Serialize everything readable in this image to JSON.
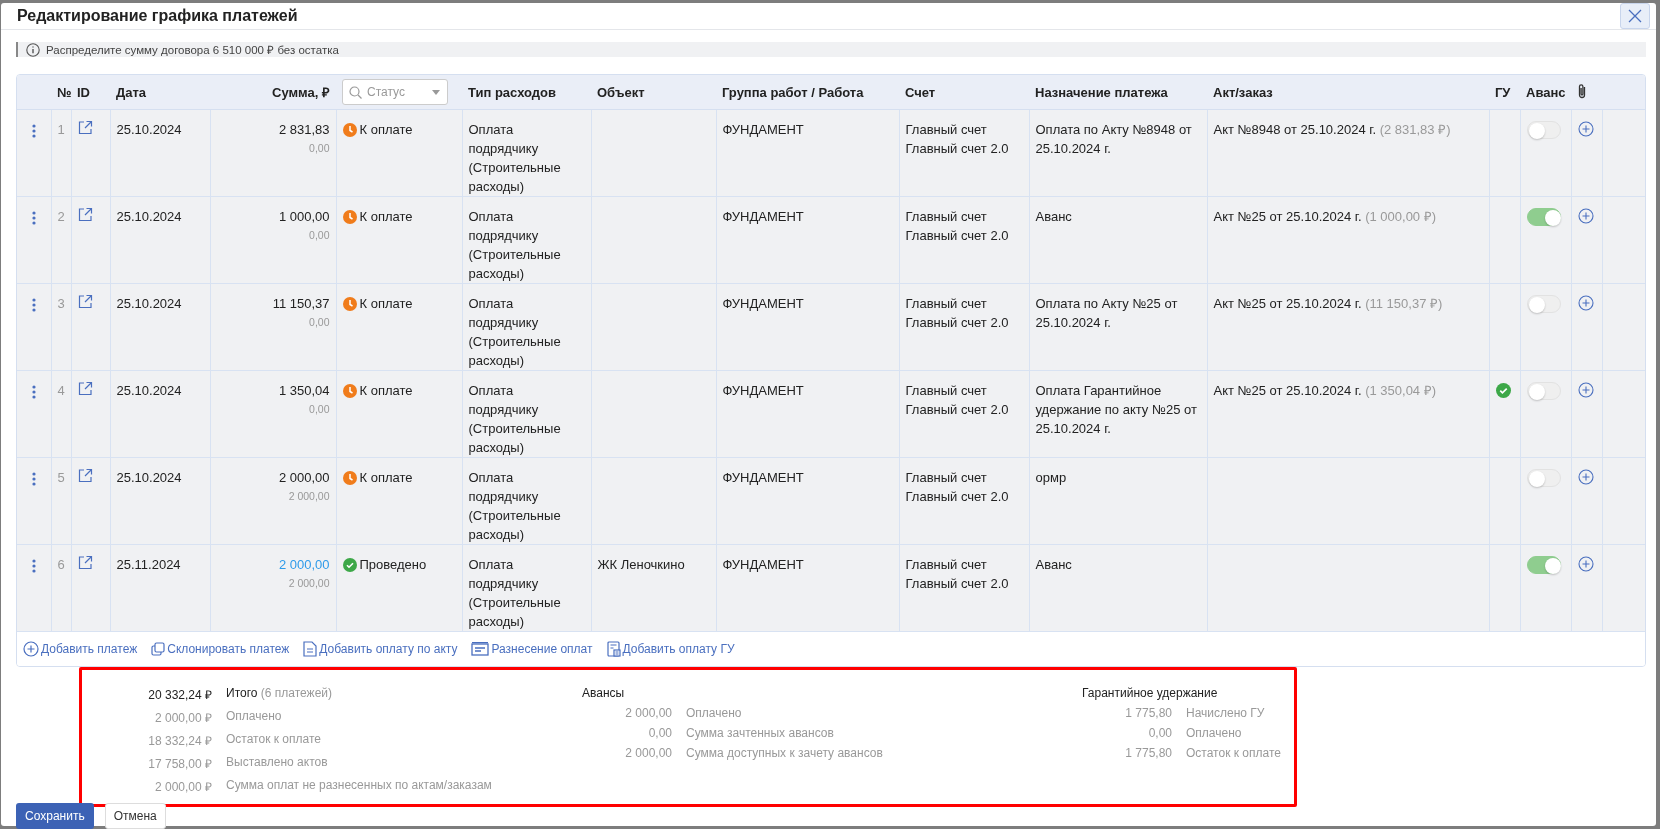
{
  "dialog": {
    "title": "Редактирование графика платежей"
  },
  "info": "Распределите сумму договора 6 510 000 ₽ без остатка",
  "table": {
    "columns": {
      "num": "№",
      "id": "ID",
      "date": "Дата",
      "amount": "Сумма, ₽",
      "status_filter": {
        "placeholder": "Статус"
      },
      "expense_type": "Тип расходов",
      "object": "Объект",
      "work_group": "Группа работ / Работа",
      "account": "Счет",
      "purpose": "Назначение платежа",
      "act": "Акт/заказ",
      "gu": "ГУ",
      "advance": "Аванс"
    },
    "rows": [
      {
        "num": "1",
        "date": "25.10.2024",
        "amount": "2 831,83",
        "amount_link": false,
        "amount_sub": "0,00",
        "status": {
          "kind": "pending",
          "label": "К оплате"
        },
        "expense_type": "Оплата подрядчику (Строительные расходы)",
        "object": "",
        "work_group": "ФУНДАМЕНТ",
        "account": [
          "Главный счет",
          "Главный счет 2.0"
        ],
        "purpose": "Оплата по Акту №8948 от 25.10.2024 г.",
        "act": "Акт №8948 от 25.10.2024 г.",
        "act_amount": "(2 831,83 ₽)",
        "gu": false,
        "advance": false
      },
      {
        "num": "2",
        "date": "25.10.2024",
        "amount": "1 000,00",
        "amount_link": false,
        "amount_sub": "0,00",
        "status": {
          "kind": "pending",
          "label": "К оплате"
        },
        "expense_type": "Оплата подрядчику (Строительные расходы)",
        "object": "",
        "work_group": "ФУНДАМЕНТ",
        "account": [
          "Главный счет",
          "Главный счет 2.0"
        ],
        "purpose": "Аванс",
        "act": "Акт №25 от 25.10.2024 г.",
        "act_amount": "(1 000,00 ₽)",
        "gu": false,
        "advance": true
      },
      {
        "num": "3",
        "date": "25.10.2024",
        "amount": "11 150,37",
        "amount_link": false,
        "amount_sub": "0,00",
        "status": {
          "kind": "pending",
          "label": "К оплате"
        },
        "expense_type": "Оплата подрядчику (Строительные расходы)",
        "object": "",
        "work_group": "ФУНДАМЕНТ",
        "account": [
          "Главный счет",
          "Главный счет 2.0"
        ],
        "purpose": "Оплата по Акту №25 от 25.10.2024 г.",
        "act": "Акт №25 от 25.10.2024 г.",
        "act_amount": "(11 150,37 ₽)",
        "gu": false,
        "advance": false
      },
      {
        "num": "4",
        "date": "25.10.2024",
        "amount": "1 350,04",
        "amount_link": false,
        "amount_sub": "0,00",
        "status": {
          "kind": "pending",
          "label": "К оплате"
        },
        "expense_type": "Оплата подрядчику (Строительные расходы)",
        "object": "",
        "work_group": "ФУНДАМЕНТ",
        "account": [
          "Главный счет",
          "Главный счет 2.0"
        ],
        "purpose": "Оплата Гарантийное удержание по акту №25 от 25.10.2024 г.",
        "act": "Акт №25 от 25.10.2024 г.",
        "act_amount": "(1 350,04 ₽)",
        "gu": true,
        "advance": false
      },
      {
        "num": "5",
        "date": "25.10.2024",
        "amount": "2 000,00",
        "amount_link": false,
        "amount_sub": "2 000,00",
        "status": {
          "kind": "pending",
          "label": "К оплате"
        },
        "expense_type": "Оплата подрядчику (Строительные расходы)",
        "object": "",
        "work_group": "ФУНДАМЕНТ",
        "account": [
          "Главный счет",
          "Главный счет 2.0"
        ],
        "purpose": "ормр",
        "act": "",
        "act_amount": "",
        "gu": false,
        "advance": false
      },
      {
        "num": "6",
        "date": "25.11.2024",
        "amount": "2 000,00",
        "amount_link": true,
        "amount_sub": "2 000,00",
        "status": {
          "kind": "done",
          "label": "Проведено"
        },
        "expense_type": "Оплата подрядчику (Строительные расходы)",
        "object": "ЖК Леночкино",
        "work_group": "ФУНДАМЕНТ",
        "account": [
          "Главный счет",
          "Главный счет 2.0"
        ],
        "purpose": "Аванс",
        "act": "",
        "act_amount": "",
        "gu": false,
        "advance": true
      }
    ]
  },
  "actions": [
    {
      "kind": "add",
      "label": "Добавить платеж"
    },
    {
      "kind": "clone",
      "label": "Склонировать платеж"
    },
    {
      "kind": "act",
      "label": "Добавить оплату по акту"
    },
    {
      "kind": "distribute",
      "label": "Разнесение оплат"
    },
    {
      "kind": "gu",
      "label": "Добавить оплату ГУ"
    }
  ],
  "summary": {
    "totals": [
      {
        "amount": "20 332,24 ₽",
        "label": "Итого",
        "note": "(6 платежей)",
        "bold": true
      },
      {
        "amount": "2 000,00 ₽",
        "label": "Оплачено",
        "bold": false
      },
      {
        "amount": "18 332,24 ₽",
        "label": "Остаток к оплате",
        "bold": false
      },
      {
        "amount": "17 758,00 ₽",
        "label": "Выставлено актов",
        "bold": false
      },
      {
        "amount": "2 000,00 ₽",
        "label": "Сумма оплат не разнесенных по актам/заказам",
        "bold": false
      }
    ],
    "advances": {
      "title": "Авансы",
      "items": [
        {
          "amount": "2 000,00",
          "label": "Оплачено"
        },
        {
          "amount": "0,00",
          "label": "Сумма зачтенных авансов"
        },
        {
          "amount": "2 000,00",
          "label": "Сумма доступных к зачету авансов"
        }
      ]
    },
    "retention": {
      "title": "Гарантийное удержание",
      "items": [
        {
          "amount": "1 775,80",
          "label": "Начислено ГУ"
        },
        {
          "amount": "0,00",
          "label": "Оплачено"
        },
        {
          "amount": "1 775,80",
          "label": "Остаток к оплате"
        }
      ]
    }
  },
  "buttons": {
    "save": "Сохранить",
    "cancel": "Отмена"
  }
}
